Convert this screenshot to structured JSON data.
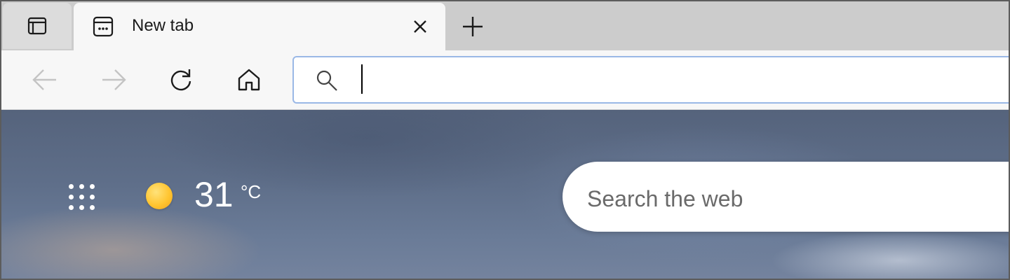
{
  "browser": {
    "tab": {
      "title": "New tab",
      "active": true
    },
    "address_bar": {
      "value": "",
      "placeholder": ""
    }
  },
  "newtab_page": {
    "weather": {
      "temperature": "31",
      "unit": "°C",
      "condition_icon": "sun-icon"
    },
    "search": {
      "placeholder": "Search the web"
    }
  },
  "icons": {
    "tab_actions": "tab-actions-icon",
    "favicon": "new-tab-page-icon",
    "close": "close-icon",
    "new_tab": "plus-icon",
    "back": "back-arrow-icon",
    "forward": "forward-arrow-icon",
    "refresh": "refresh-icon",
    "home": "home-icon",
    "search": "search-icon",
    "apps": "app-launcher-icon"
  },
  "colors": {
    "tabstrip": "#cccccc",
    "active_tab": "#f7f7f7",
    "address_border": "#9ab8e6",
    "disabled_icon": "#c4c4c4"
  }
}
